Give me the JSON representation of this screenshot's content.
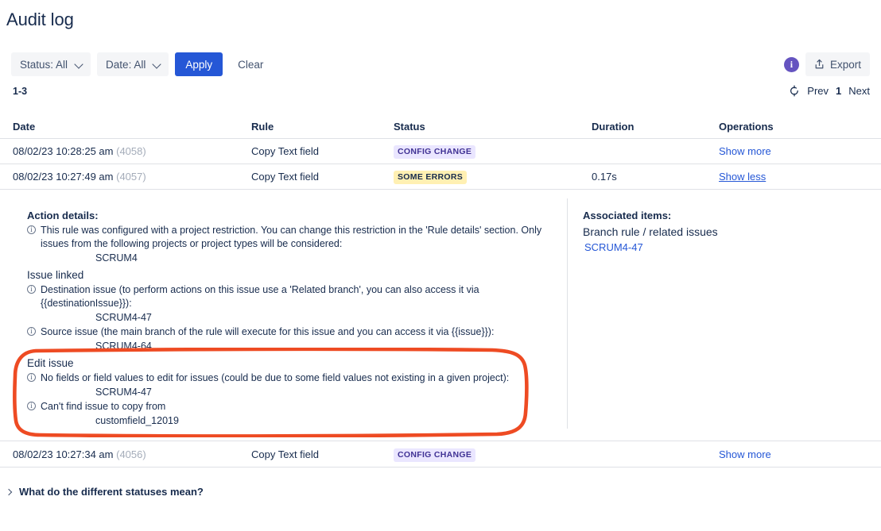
{
  "page": {
    "title": "Audit log"
  },
  "filters": {
    "status": {
      "label": "Status: All",
      "icon": "chevron-down-icon"
    },
    "date": {
      "label": "Date: All",
      "icon": "chevron-down-icon"
    },
    "apply_label": "Apply",
    "clear_label": "Clear",
    "apply_color": "#2557D6"
  },
  "toolbar": {
    "info_icon": "info-circle-icon",
    "info_glyph": "i",
    "info_color": "#6554C0",
    "export_label": "Export",
    "export_icon": "upload-export-icon"
  },
  "results": {
    "count_label": "1-3"
  },
  "pagination": {
    "refresh_icon": "refresh-icon",
    "prev_label": "Prev",
    "current_page": "1",
    "next_label": "Next"
  },
  "table": {
    "columns": [
      "Date",
      "Rule",
      "Status",
      "Duration",
      "Operations"
    ],
    "rows": [
      {
        "date": "08/02/23 10:28:25 am",
        "id": "(4058)",
        "rule": "Copy Text field",
        "status": "CONFIG CHANGE",
        "status_kind": "config",
        "duration": "",
        "operation": "Show more",
        "operation_underline": false
      },
      {
        "date": "08/02/23 10:27:49 am",
        "id": "(4057)",
        "rule": "Copy Text field",
        "status": "SOME ERRORS",
        "status_kind": "errors",
        "duration": "0.17s",
        "operation": "Show less",
        "operation_underline": true
      },
      {
        "date": "08/02/23 10:27:34 am",
        "id": "(4056)",
        "rule": "Copy Text field",
        "status": "CONFIG CHANGE",
        "status_kind": "config",
        "duration": "",
        "operation": "Show more",
        "operation_underline": false
      }
    ],
    "badge_colors": {
      "config_bg": "#EAE6FF",
      "config_fg": "#403294",
      "errors_bg": "#FFF0B3",
      "errors_fg": "#172B4D"
    }
  },
  "detail": {
    "action_details_heading": "Action details:",
    "project_restriction_text": "This rule was configured with a project restriction. You can change this restriction in the 'Rule details' section. Only",
    "project_restriction_text2": "issues from the following projects or project types will be considered:",
    "project_restriction_value": "SCRUM4",
    "issue_linked_heading": "Issue linked",
    "destination_text": "Destination issue (to perform actions on this issue use a 'Related branch', you can also access it via",
    "destination_text2": "{{destinationIssue}}):",
    "destination_value": "SCRUM4-47",
    "source_text": "Source issue (the main branch of the rule will execute for this issue and you can access it via {{issue}}):",
    "source_value": "SCRUM4-64",
    "edit_issue_heading": "Edit issue",
    "no_fields_text": "No fields or field values to edit for issues (could be due to some field values not existing in a given project):",
    "no_fields_value": "SCRUM4-47",
    "cant_find_text": "Can't find issue to copy from",
    "cant_find_value": "customfield_12019",
    "info_icon": "info-circle-outline-icon",
    "highlight_color": "#EE4B23"
  },
  "associated": {
    "heading": "Associated items:",
    "subheading": "Branch rule / related issues",
    "link": "SCRUM4-47"
  },
  "footer": {
    "expander_icon": "chevron-right-icon",
    "label": "What do the different statuses mean?"
  }
}
